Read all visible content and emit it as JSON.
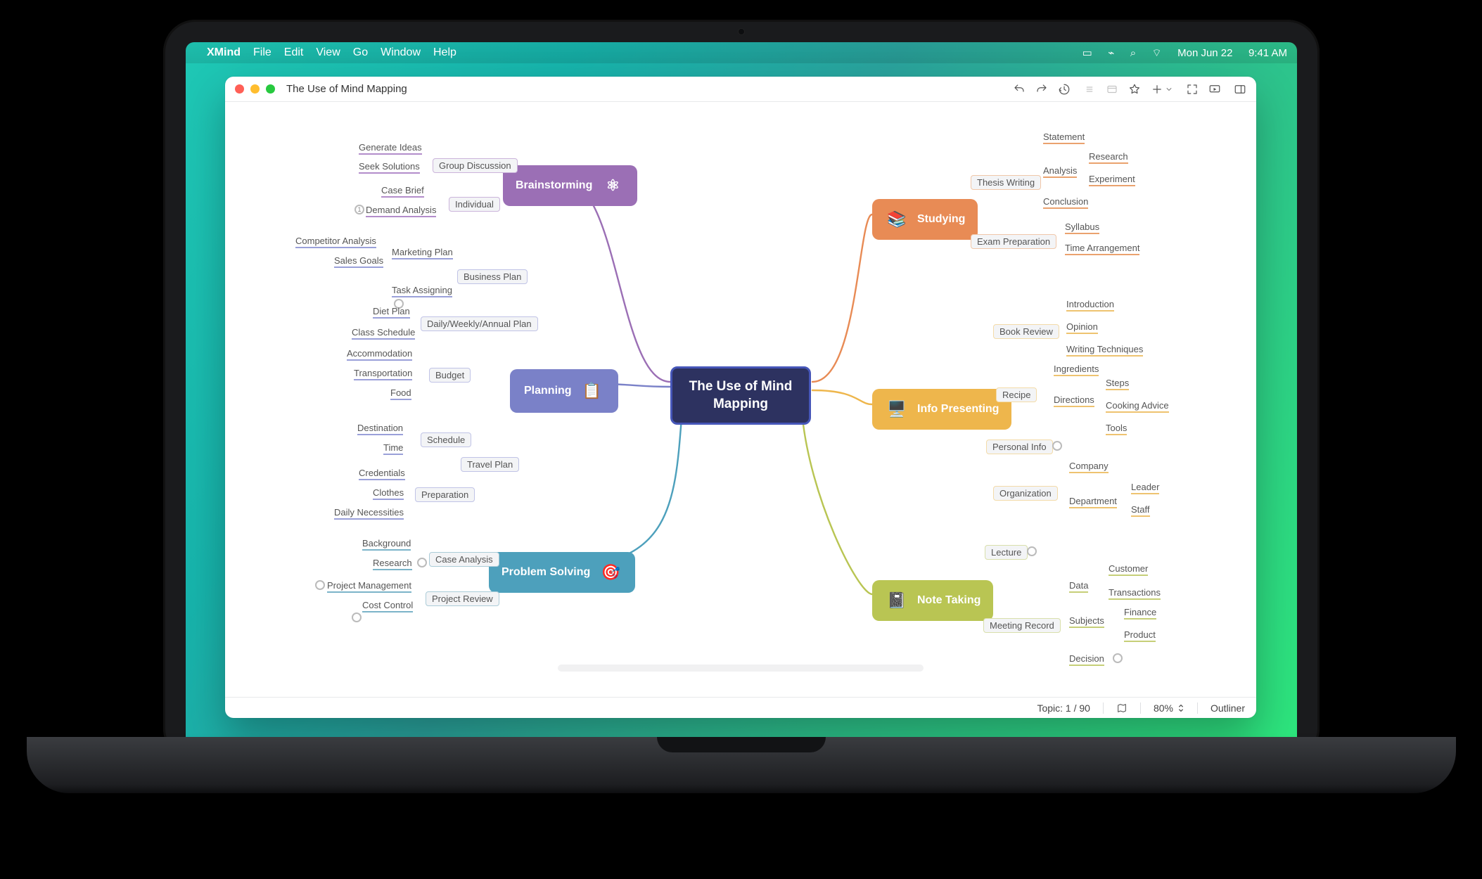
{
  "menubar": {
    "app": "XMind",
    "items": [
      "File",
      "Edit",
      "View",
      "Go",
      "Window",
      "Help"
    ],
    "clock_day": "Mon Jun 22",
    "clock_time": "9:41 AM"
  },
  "window": {
    "title": "The Use of Mind Mapping"
  },
  "statusbar": {
    "topic": "Topic: 1 / 90",
    "zoom": "80%",
    "outliner": "Outliner"
  },
  "mindmap": {
    "central": "The Use of Mind\nMapping",
    "brainstorming": {
      "label": "Brainstorming",
      "group_discussion": "Group Discussion",
      "individual": "Individual",
      "generate_ideas": "Generate Ideas",
      "seek_solutions": "Seek Solutions",
      "case_brief": "Case Brief",
      "demand_analysis": "Demand Analysis"
    },
    "planning": {
      "label": "Planning",
      "business_plan": "Business Plan",
      "marketing_plan": "Marketing Plan",
      "task_assigning": "Task Assigning",
      "competitor_analysis": "Competitor Analysis",
      "sales_goals": "Sales Goals",
      "daily_plan": "Daily/Weekly/Annual Plan",
      "diet_plan": "Diet Plan",
      "class_schedule": "Class Schedule",
      "budget": "Budget",
      "accommodation": "Accommodation",
      "transportation": "Transportation",
      "food": "Food",
      "travel_plan": "Travel Plan",
      "schedule": "Schedule",
      "destination": "Destination",
      "time": "Time",
      "preparation": "Preparation",
      "credentials": "Credentials",
      "clothes": "Clothes",
      "daily_necessities": "Daily Necessities"
    },
    "problem_solving": {
      "label": "Problem Solving",
      "case_analysis": "Case Analysis",
      "project_review": "Project Review",
      "background": "Background",
      "research": "Research",
      "project_management": "Project Management",
      "cost_control": "Cost Control"
    },
    "studying": {
      "label": "Studying",
      "thesis_writing": "Thesis Writing",
      "exam_preparation": "Exam Preparation",
      "statement": "Statement",
      "analysis": "Analysis",
      "conclusion": "Conclusion",
      "research": "Research",
      "experiment": "Experiment",
      "syllabus": "Syllabus",
      "time_arrangement": "Time Arrangement"
    },
    "info_presenting": {
      "label": "Info Presenting",
      "book_review": "Book Review",
      "introduction": "Introduction",
      "opinion": "Opinion",
      "writing_techniques": "Writing Techniques",
      "recipe": "Recipe",
      "ingredients": "Ingredients",
      "directions": "Directions",
      "steps": "Steps",
      "cooking_advice": "Cooking Advice",
      "tools": "Tools",
      "personal_info": "Personal Info",
      "organization": "Organization",
      "company": "Company",
      "department": "Department",
      "leader": "Leader",
      "staff": "Staff"
    },
    "note_taking": {
      "label": "Note Taking",
      "lecture": "Lecture",
      "meeting_record": "Meeting Record",
      "data": "Data",
      "customer": "Customer",
      "transactions": "Transactions",
      "subjects": "Subjects",
      "finance": "Finance",
      "product": "Product",
      "decision": "Decision"
    }
  }
}
